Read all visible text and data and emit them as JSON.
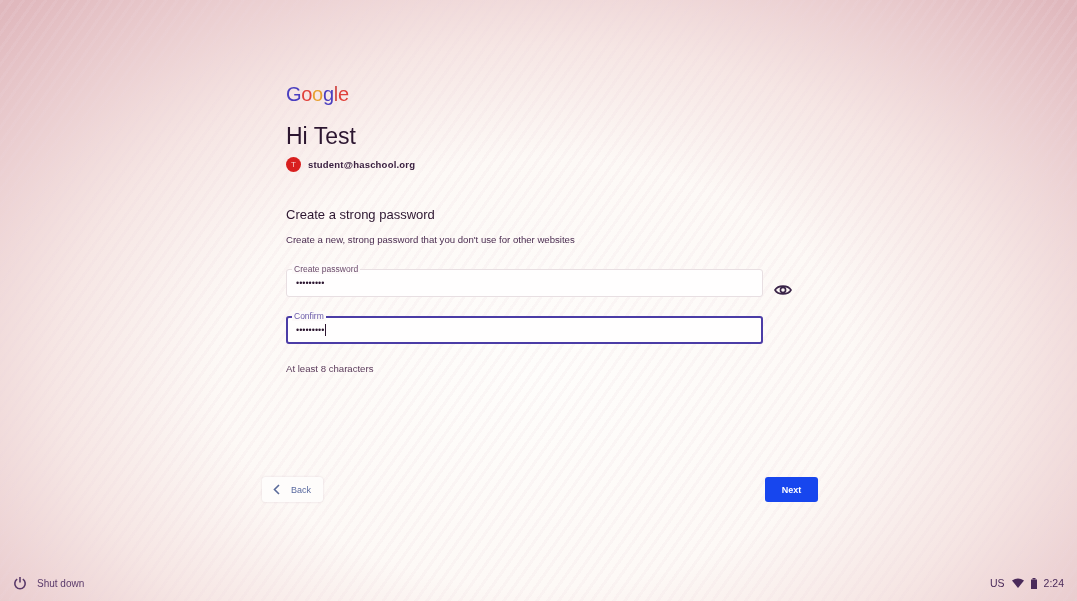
{
  "logo": {
    "text": "Google"
  },
  "greeting": "Hi Test",
  "account": {
    "avatar": "T",
    "email": "student@haschool.org"
  },
  "heading": "Create a strong password",
  "description": "Create a new, strong password that you don't use for other websites",
  "fields": [
    {
      "label": "Create password",
      "value": "•••••••••",
      "focused": false
    },
    {
      "label": "Confirm",
      "value": "•••••••••",
      "focused": true
    }
  ],
  "hint": "At least 8 characters",
  "buttons": [
    {
      "kind": "back",
      "label": "Back"
    },
    {
      "kind": "next",
      "label": "Next"
    }
  ],
  "shelf": {
    "shutdown": "Shut down",
    "keyboard": "US",
    "time": "2:24"
  }
}
